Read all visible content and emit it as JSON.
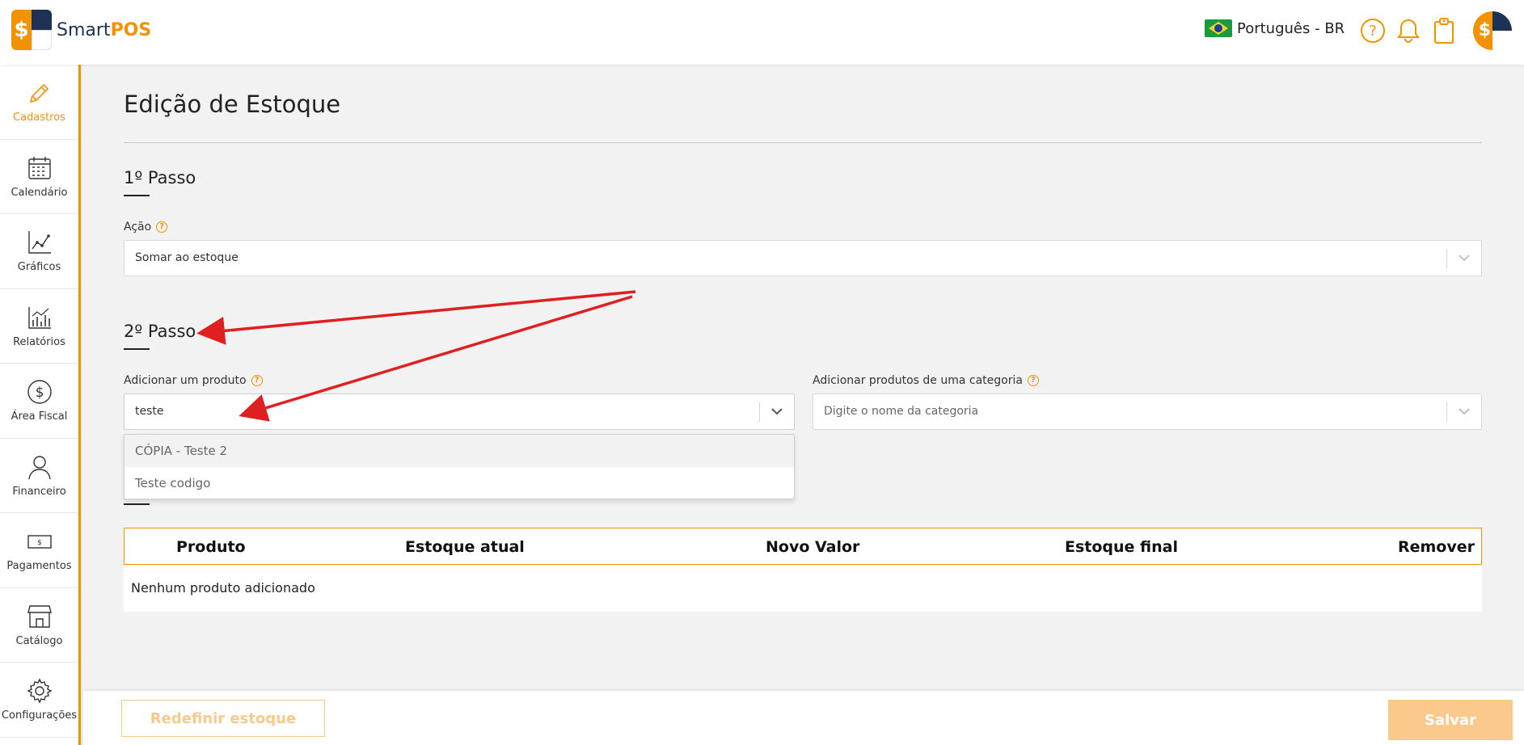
{
  "brand": {
    "name_part1": "Smart",
    "name_part2": "POS"
  },
  "header": {
    "language": "Português - BR"
  },
  "sidebar": {
    "items": [
      {
        "label": "Cadastros"
      },
      {
        "label": "Calendário"
      },
      {
        "label": "Gráficos"
      },
      {
        "label": "Relatórios"
      },
      {
        "label": "Área Fiscal"
      },
      {
        "label": "Financeiro"
      },
      {
        "label": "Pagamentos"
      },
      {
        "label": "Catálogo"
      },
      {
        "label": "Configurações"
      }
    ]
  },
  "page": {
    "title": "Edição de Estoque",
    "step1": {
      "title": "1º Passo",
      "action_label": "Ação",
      "action_value": "Somar ao estoque"
    },
    "step2": {
      "title": "2º Passo",
      "product_label": "Adicionar um produto",
      "product_value": "teste",
      "category_label": "Adicionar produtos de uma categoria",
      "category_placeholder": "Digite o nome da categoria",
      "dropdown_options": [
        "CÓPIA - Teste 2",
        "Teste codigo"
      ]
    },
    "table": {
      "columns": [
        "Produto",
        "Estoque atual",
        "Novo Valor",
        "Estoque final",
        "Remover"
      ],
      "empty_message": "Nenhum produto adicionado"
    }
  },
  "footer": {
    "reset_label": "Redefinir estoque",
    "save_label": "Salvar"
  },
  "colors": {
    "accent": "#f39200",
    "brand_dark": "#1c3256",
    "annotation_arrow": "#e02020"
  }
}
